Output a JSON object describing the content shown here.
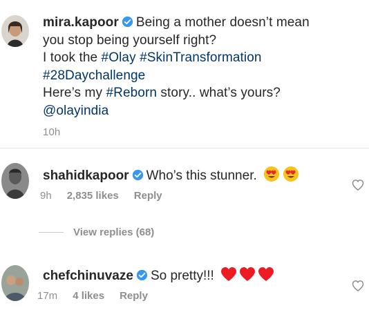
{
  "post": {
    "username": "mira.kapoor",
    "caption_line1": "Being a mother doesn’t mean",
    "caption_line2": "you stop being yourself right?",
    "caption_line3_prefix": "I took the ",
    "tag_olay": "#Olay",
    "tag_skin": "#SkinTransformation",
    "tag_28": "#28Daychallenge",
    "caption_line5_prefix": "Here’s my ",
    "tag_reborn": "#Reborn",
    "caption_line5_suffix": " story.. what’s yours?",
    "mention": "@olayindia",
    "time": "10h"
  },
  "comments": [
    {
      "username": "shahidkapoor",
      "text": "Who’s this stunner.",
      "emoji": "heart-eyes",
      "time": "9h",
      "likes": "2,835 likes",
      "reply": "Reply"
    },
    {
      "username": "chefchinuvaze",
      "text": "So pretty!!!",
      "emoji": "red-heart",
      "time": "17m",
      "likes": "4 likes",
      "reply": "Reply"
    }
  ],
  "view_replies": "View replies (68)",
  "icons": {
    "verified": "verified-badge-icon",
    "like": "heart-outline-icon"
  },
  "colors": {
    "verified_blue": "#3897f0",
    "hashtag": "#003569",
    "meta_gray": "#8e8e8e",
    "heart_red": "#ed1c24"
  }
}
